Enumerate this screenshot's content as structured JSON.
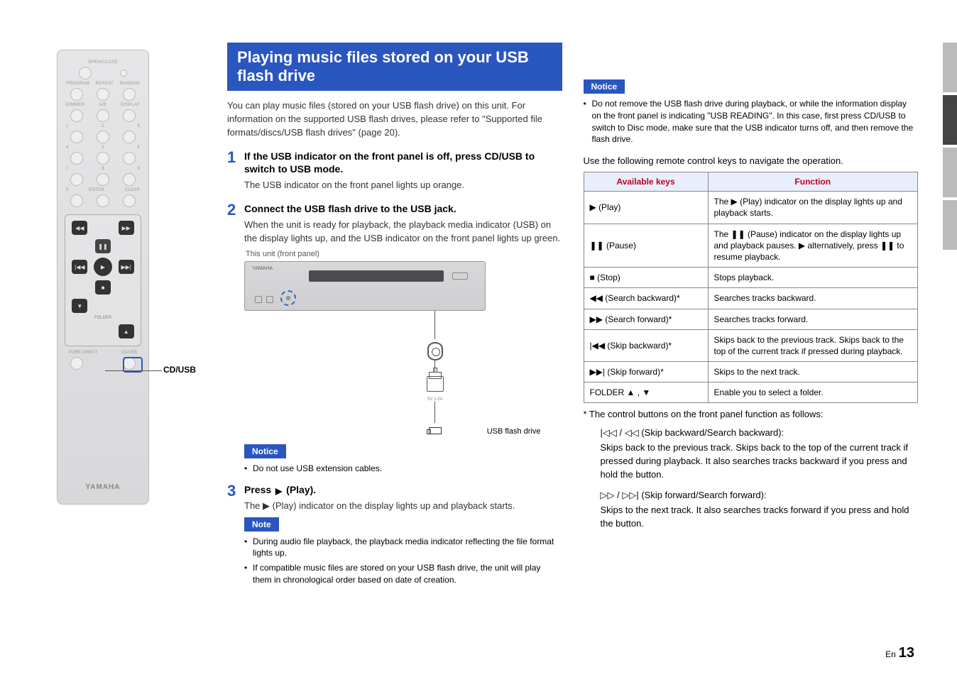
{
  "heading": "Playing music files stored on your USB flash drive",
  "intro": "You can play music files (stored on your USB flash drive) on this unit. For information on the supported USB flash drives, please refer to \"Supported file formats/discs/USB flash drives\" (page 20).",
  "steps": {
    "s1": {
      "num": "1",
      "title": "If the USB indicator on the front panel is off, press CD/USB to switch to USB mode.",
      "body": "The USB indicator on the front panel lights up orange."
    },
    "s2": {
      "num": "2",
      "title": "Connect the USB flash drive to the USB jack.",
      "body": "When the unit is ready for playback, the playback media indicator (USB) on the display lights up, and the USB indicator on the front panel lights up green."
    },
    "s3": {
      "num": "3",
      "titlePrefix": "Press ",
      "titleSuffix": " (Play).",
      "body": "The ▶ (Play) indicator on the display lights up and playback starts."
    }
  },
  "panelCaption": "This unit (front panel)",
  "usbFlashLabel": "USB flash drive",
  "noticeLabel": "Notice",
  "noteLabel": "Note",
  "noticeLeft": "Do not use USB extension cables.",
  "note1": "During audio file playback, the playback media indicator reflecting the file format lights up.",
  "note2": "If compatible music files are stored on your USB flash drive, the unit will play them in chronological order based on date of creation.",
  "noticeRight": "Do not remove the USB flash drive during playback, or while the information display on the front panel is indicating \"USB READING\". In this case, first press CD/USB to switch to Disc mode, make sure that the USB indicator turns off, and then remove the flash drive.",
  "tableLead": "Use the following remote control keys to navigate the operation.",
  "tableHead": {
    "keys": "Available keys",
    "func": "Function"
  },
  "rows": {
    "play": {
      "key": "▶ (Play)",
      "func": "The ▶ (Play) indicator on the display lights up and playback starts."
    },
    "pause": {
      "key": "❚❚ (Pause)",
      "func": "The ❚❚ (Pause) indicator on the display lights up and playback pauses. ▶ alternatively, press ❚❚ to resume playback."
    },
    "stop": {
      "key": "■ (Stop)",
      "func": "Stops playback."
    },
    "sb": {
      "key": "◀◀ (Search backward)*",
      "func": "Searches tracks backward."
    },
    "sf": {
      "key": "▶▶ (Search forward)*",
      "func": "Searches tracks forward."
    },
    "skb": {
      "key": "|◀◀ (Skip backward)*",
      "func": "Skips back to the previous track. Skips back to the top of the current track if pressed during playback."
    },
    "skf": {
      "key": "▶▶| (Skip forward)*",
      "func": "Skips to the next track."
    },
    "fld": {
      "key": "FOLDER ▲ , ▼",
      "func": "Enable you to select a folder."
    }
  },
  "footnote": "*  The control buttons on the front panel function as follows:",
  "fn1": {
    "head": "|◁◁ / ◁◁ (Skip backward/Search backward):",
    "body": "Skips back to the previous track. Skips back to the top of the current track if pressed during playback. It also searches tracks backward if you press and hold the button."
  },
  "fn2": {
    "head": "▷▷ / ▷▷| (Skip forward/Search forward):",
    "body": "Skips to the next track. It also searches tracks forward if you press and hold the button."
  },
  "remoteCallout": "CD/USB",
  "remoteLabels": {
    "openclose": "OPEN/CLOSE",
    "program": "PROGRAM",
    "repeat": "REPEAT",
    "random": "RANDOM",
    "dimmer": "DIMMER",
    "ab": "A/B",
    "display": "DISPLAY",
    "enter": "ENTER",
    "clear": "CLEAR",
    "puredirect": "PURE DIRECT",
    "cdusb": "CD/USB",
    "folder": "FOLDER"
  },
  "brand": "YAMAHA",
  "pageLang": "En",
  "pageNum": "13"
}
